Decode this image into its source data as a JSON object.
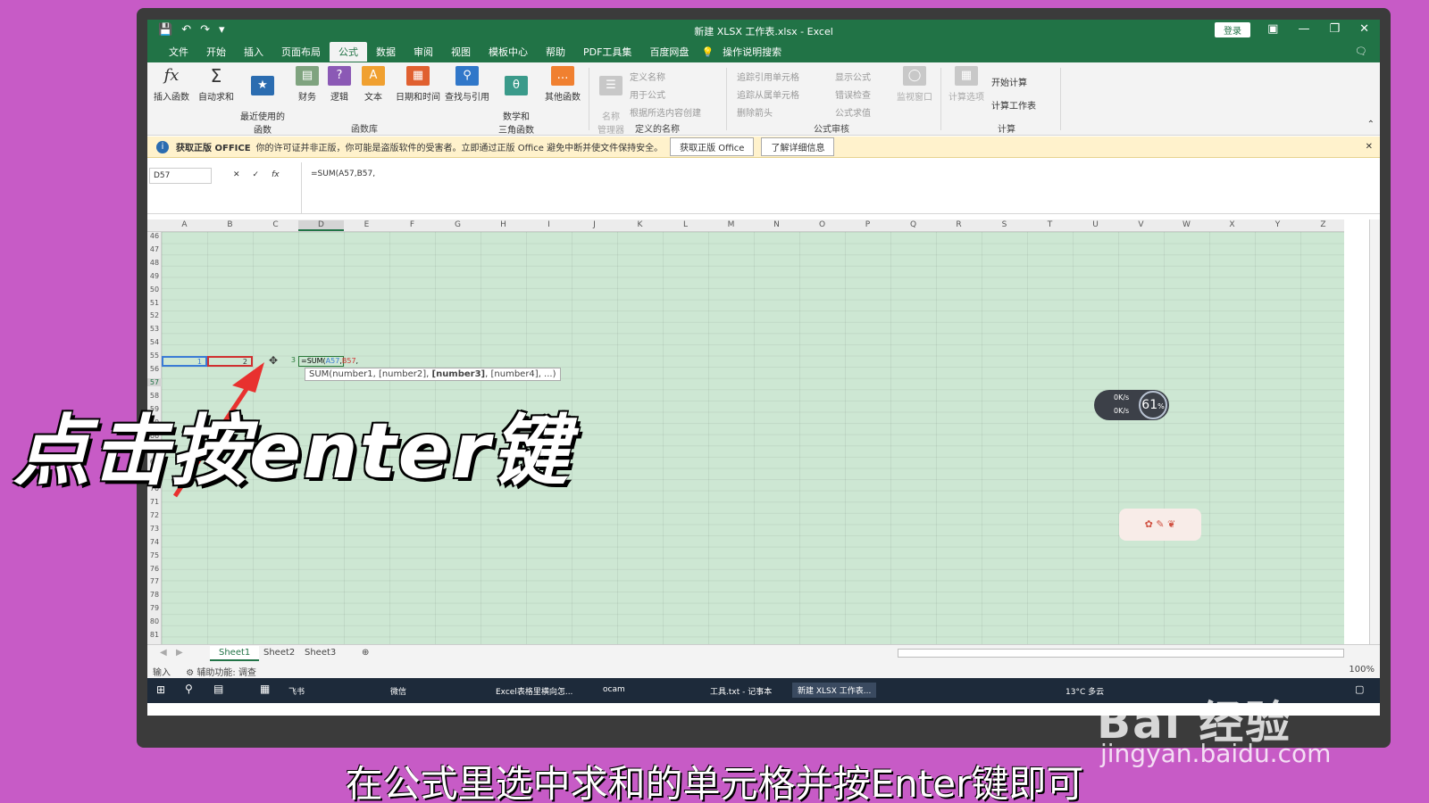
{
  "titlebar": {
    "title": "新建 XLSX 工作表.xlsx  -  Excel",
    "login": "登录"
  },
  "menu": [
    "文件",
    "开始",
    "插入",
    "页面布局",
    "公式",
    "数据",
    "审阅",
    "视图",
    "模板中心",
    "帮助",
    "PDF工具集",
    "百度网盘"
  ],
  "menu_active": "公式",
  "tell_me": "操作说明搜索",
  "ribbon": {
    "insert_function": "插入函数",
    "autosum": "自动求和",
    "recent": "最近使用的\n函数",
    "financial": "财务",
    "logical": "逻辑",
    "text": "文本",
    "datetime": "日期和时间",
    "lookup": "查找与引用",
    "math": "数学和\n三角函数",
    "more": "其他函数",
    "group_library": "函数库",
    "name_manager": "名称\n管理器",
    "define_name": "定义名称",
    "use_in_formula": "用于公式",
    "create_from_selection": "根据所选内容创建",
    "group_names": "定义的名称",
    "trace_precedents": "追踪引用单元格",
    "trace_dependents": "追踪从属单元格",
    "remove_arrows": "删除箭头",
    "show_formulas": "显示公式",
    "error_checking": "错误检查",
    "evaluate_formula": "公式求值",
    "watch_window": "监视窗口",
    "group_auditing": "公式审核",
    "calc_options": "计算选项",
    "calc_now": "开始计算",
    "calc_sheet": "计算工作表",
    "group_calc": "计算"
  },
  "notice": {
    "title": "获取正版 OFFICE",
    "text": "你的许可证并非正版，你可能是盗版软件的受害者。立即通过正版 Office 避免中断并使文件保持安全。",
    "btn_get": "获取正版 Office",
    "btn_more": "了解详细信息"
  },
  "formula_bar": {
    "name_box": "D57",
    "formula": "=SUM(A57,B57,"
  },
  "columns": [
    "A",
    "B",
    "C",
    "D",
    "E",
    "F",
    "G",
    "H",
    "I",
    "J",
    "K",
    "L",
    "M",
    "N",
    "O",
    "P",
    "Q",
    "R",
    "S",
    "T",
    "U",
    "V",
    "W",
    "X",
    "Y",
    "Z"
  ],
  "rows": [
    "46",
    "47",
    "48",
    "49",
    "50",
    "51",
    "52",
    "53",
    "54",
    "55",
    "56",
    "57",
    "58",
    "59",
    "60",
    "66",
    "67",
    "68",
    "69",
    "70",
    "71",
    "72",
    "73",
    "74",
    "75",
    "76",
    "77",
    "78",
    "79",
    "80",
    "81"
  ],
  "cells": {
    "a57": "1",
    "b57": "2",
    "c57": "3",
    "d57_formula_1": "=SUM(",
    "d57_formula_ref1": "A57",
    "d57_formula_ref2": "B57",
    "d57_formula_tail": ","
  },
  "tooltip": {
    "pre": "SUM(number1, [number2], ",
    "bold": "[number3]",
    "post": ", [number4], ...)"
  },
  "sheets": [
    "Sheet1",
    "Sheet2",
    "Sheet3"
  ],
  "status": {
    "mode": "输入",
    "accessibility": "辅助功能: 调查",
    "zoom": "100%"
  },
  "taskbar": {
    "feishu": "飞书",
    "wechat": "微信",
    "chrome": "Excel表格里横向怎...",
    "ocam": "ocam",
    "notepad": "工具.txt - 记事本",
    "excel": "新建 XLSX 工作表...",
    "weather": "13°C 多云"
  },
  "net_widget": {
    "up": "0K/s",
    "down": "0K/s",
    "percent": "61",
    "percent_unit": "%"
  },
  "overlay": {
    "caption": "点击按enter键",
    "subtitle": "在公式里选中求和的单元格并按Enter键即可",
    "watermark": "Bai 经验",
    "watermark_url": "jingyan.baidu.com"
  }
}
